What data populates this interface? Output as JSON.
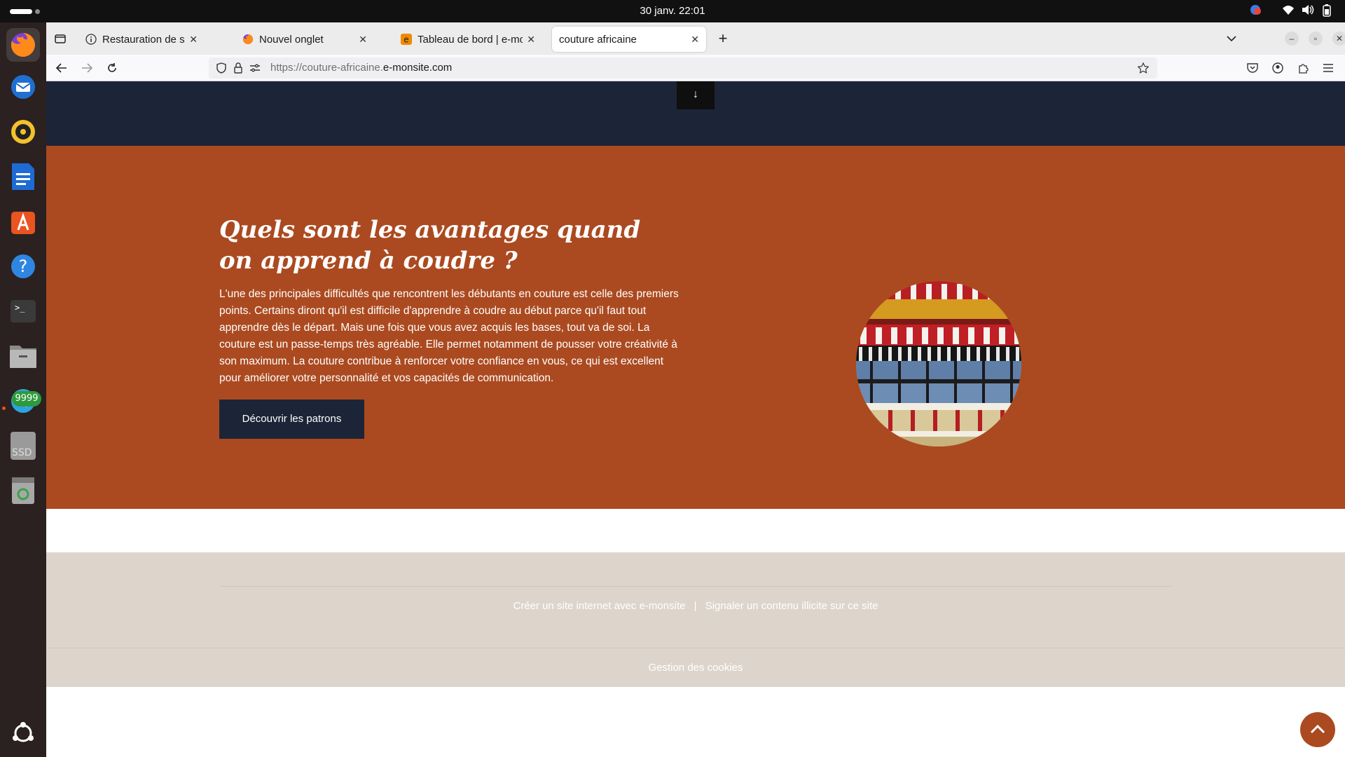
{
  "system": {
    "clock": "30 janv.  22:01"
  },
  "dock": {
    "telegram_badge": "9999",
    "ssd_label": "SSD"
  },
  "browser": {
    "tabs": [
      {
        "title": "Restauration de session"
      },
      {
        "title": "Nouvel onglet"
      },
      {
        "title": "Tableau de bord | e-monsite"
      },
      {
        "title": "couture africaine"
      }
    ],
    "url_prefix": "https://couture-africaine.",
    "url_host": "e-monsite.com"
  },
  "page": {
    "down_arrow": "↓",
    "heading": "Quels sont les avantages quand on apprend à coudre ?",
    "paragraph": "L'une des principales difficultés que rencontrent les débutants en couture est celle des premiers points. Certains diront qu'il est difficile d'apprendre à coudre au début parce qu'il faut tout apprendre dès le départ. Mais une fois que vous avez acquis les bases, tout va de soi. La couture est un passe-temps très agréable. Elle permet notamment de pousser votre créativité à son maximum. La couture contribue à renforcer votre confiance en vous, ce qui est excellent pour améliorer votre personnalité et vos capacités de communication.",
    "cta_label": "Découvrir les patrons",
    "footer_link_create": "Créer un site internet avec e-monsite",
    "footer_separator": "|",
    "footer_link_report": "Signaler un contenu illicite sur ce site",
    "cookies_label": "Gestion des cookies"
  },
  "colors": {
    "accent_orange": "#ab4a20",
    "navy": "#1c2437",
    "footer_beige": "#ddd5cc"
  }
}
